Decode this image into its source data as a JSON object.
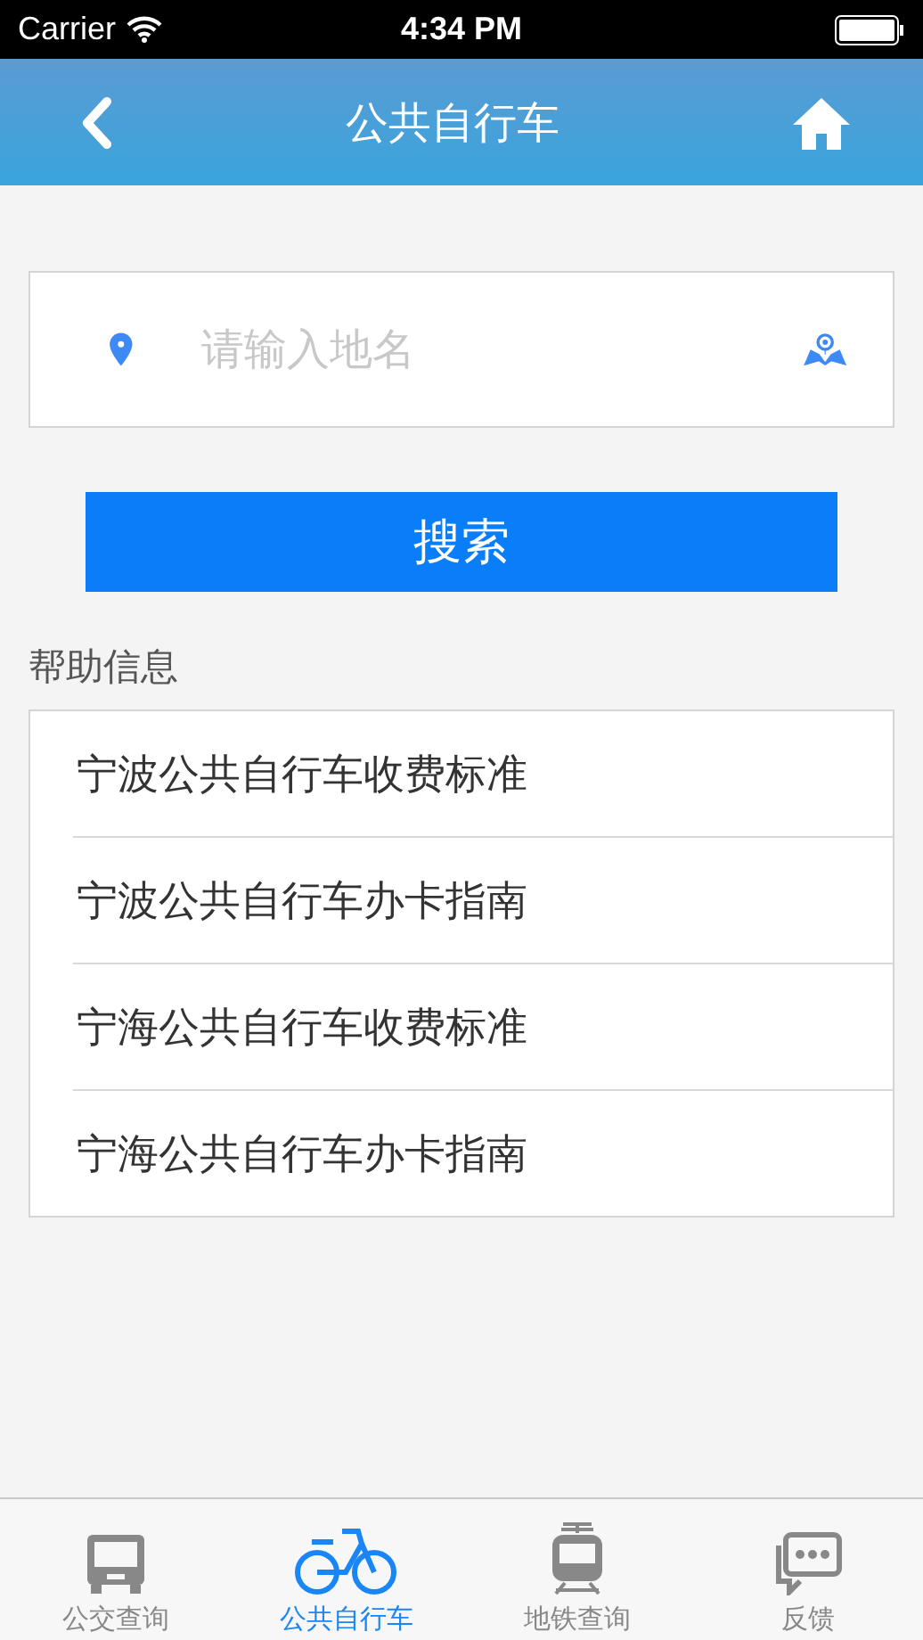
{
  "status_bar": {
    "carrier": "Carrier",
    "time": "4:34 PM"
  },
  "nav": {
    "title": "公共自行车"
  },
  "search": {
    "placeholder": "请输入地名",
    "button": "搜索"
  },
  "help": {
    "title": "帮助信息",
    "items": [
      {
        "label": "宁波公共自行车收费标准"
      },
      {
        "label": "宁波公共自行车办卡指南"
      },
      {
        "label": "宁海公共自行车收费标准"
      },
      {
        "label": "宁海公共自行车办卡指南"
      }
    ]
  },
  "tabs": [
    {
      "kind": "bus",
      "label": "公交查询",
      "selected": false
    },
    {
      "kind": "bike",
      "label": "公共自行车",
      "selected": true
    },
    {
      "kind": "tram",
      "label": "地铁查询",
      "selected": false
    },
    {
      "kind": "chat",
      "label": "反馈",
      "selected": false
    }
  ]
}
